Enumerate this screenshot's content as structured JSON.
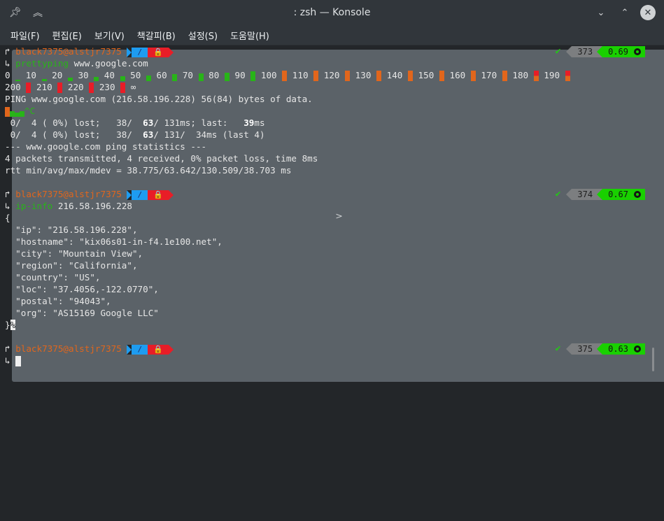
{
  "window": {
    "title": ": zsh — Konsole",
    "terminal_icon": "terminal-icon",
    "pin_icon": "pin-icon",
    "shade_icon": "chevrons-up-icon",
    "controls": [
      "chevron-down-icon",
      "chevron-up-icon",
      "close-icon"
    ]
  },
  "menu": [
    "파일(F)",
    "편집(E)",
    "보기(V)",
    "책갈피(B)",
    "설정(S)",
    "도움말(H)"
  ],
  "prompt": {
    "corner": "↱",
    "user_host": "black7375@alstjr7375",
    "dir": "/",
    "lock_icon": "🔒",
    "cmd_arrow": "↳",
    "check": "✔"
  },
  "blocks": [
    {
      "history": "373",
      "time": "0.69",
      "command": "prettyping",
      "command_arg": " www.google.com"
    },
    {
      "history": "374",
      "time": "0.67",
      "command": "ip-info",
      "command_arg": " 216.58.196.228"
    },
    {
      "history": "375",
      "time": "0.63"
    }
  ],
  "ping": {
    "scale_row1": [
      "0",
      "10",
      "20",
      "30",
      "40",
      "50",
      "60",
      "70",
      "80",
      "90",
      "100",
      "110",
      "120",
      "130",
      "140",
      "150",
      "160",
      "170",
      "180",
      "190"
    ],
    "scale_row2": [
      "200",
      "210",
      "220",
      "230"
    ],
    "infinity": "∞",
    "header": "PING www.google.com (216.58.196.228) 56(84) bytes of data.",
    "interrupt": "^C",
    "stats1_a": " 0/  4 ( 0%) lost;   38/  ",
    "stats1_b": "63",
    "stats1_c": "/ 131ms; last:   ",
    "stats1_d": "39",
    "stats1_e": "ms",
    "stats2": " 0/  4 ( 0%) lost;   38/  ",
    "stats2_b": "63",
    "stats2_c": "/ 131/  34ms (last 4)",
    "summary1": "--- www.google.com ping statistics ---",
    "summary2": "4 packets transmitted, 4 received, 0% packet loss, time 8ms",
    "summary3": "rtt min/avg/max/mdev = 38.775/63.642/130.509/38.703 ms"
  },
  "json_output": [
    "{",
    "  \"ip\": \"216.58.196.228\",",
    "  \"hostname\": \"kix06s01-in-f4.1e100.net\",",
    "  \"city\": \"Mountain View\",",
    "  \"region\": \"California\",",
    "  \"country\": \"US\",",
    "  \"loc\": \"37.4056,-122.0770\",",
    "  \"postal\": \"94043\",",
    "  \"org\": \"AS15169 Google LLC\"",
    "}",
    "%"
  ],
  "colors": {
    "bg": "#232629",
    "orange": "#e1661c",
    "green": "#28b418",
    "blue_segment": "#1e9cf0",
    "red_segment": "#e81d27",
    "grey_segment": "#7c7e80",
    "green_segment": "#19d000"
  }
}
